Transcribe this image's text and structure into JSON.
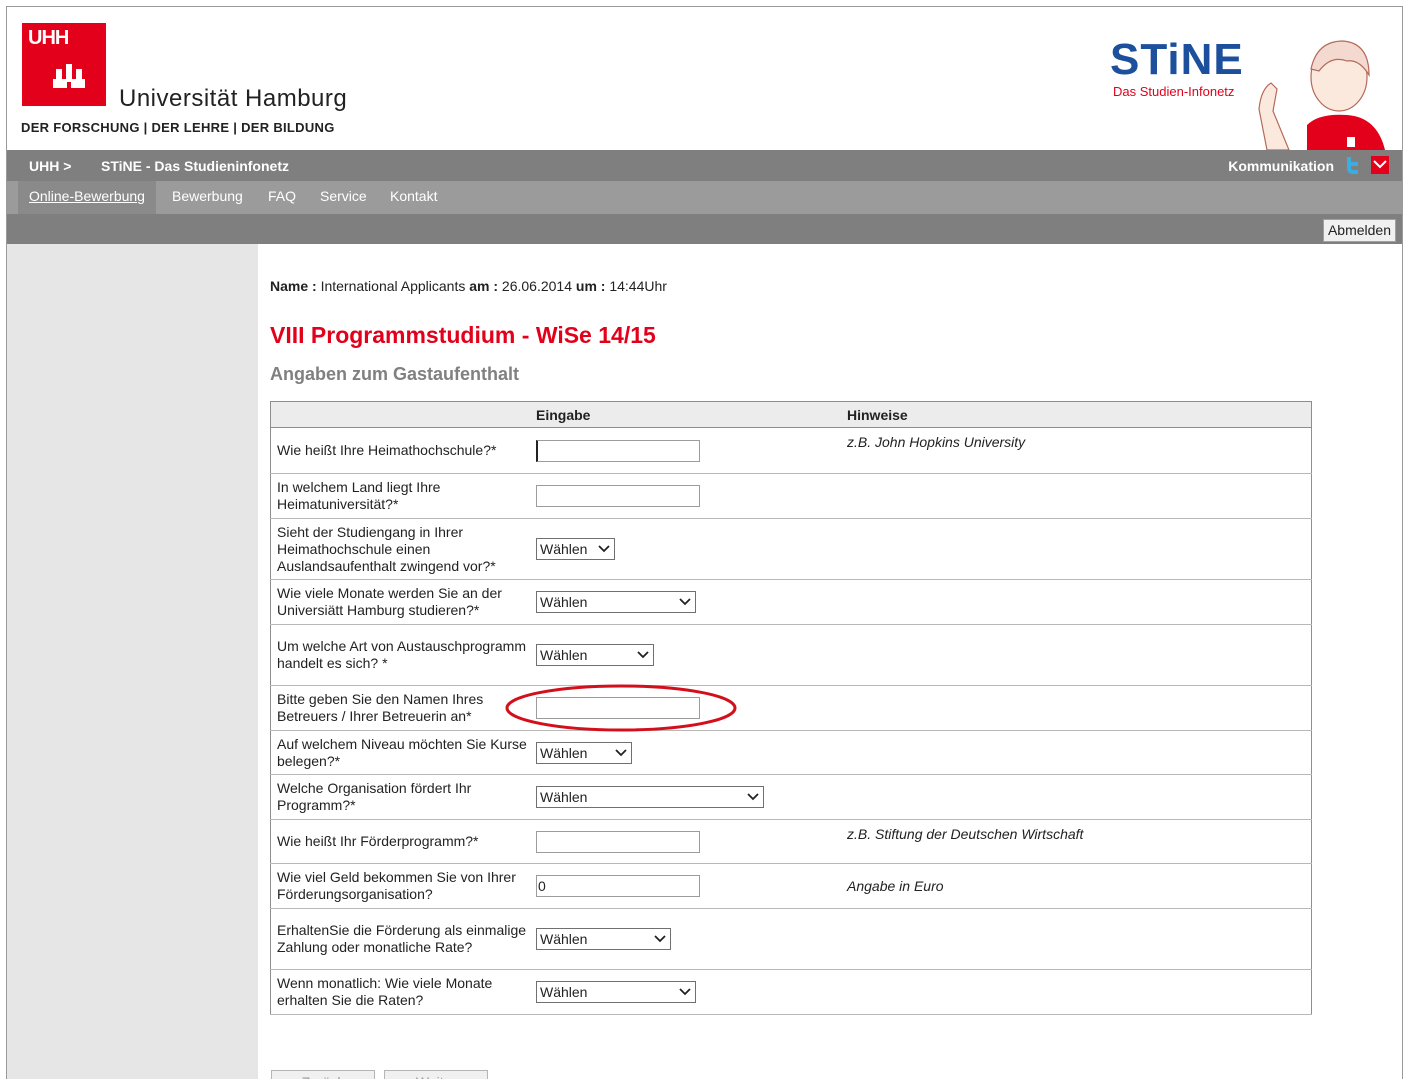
{
  "header": {
    "logo_abbr": "UHH",
    "university_name": "Universität Hamburg",
    "motto": "DER FORSCHUNG | DER LEHRE | DER BILDUNG",
    "stine_title": "STiNE",
    "stine_subtitle": "Das Studien-Infonetz"
  },
  "breadcrumb": {
    "home": "UHH >",
    "current": "STiNE - Das Studieninfonetz"
  },
  "topbar": {
    "communication": "Kommunikation",
    "twitter_icon": "twitter-icon",
    "mail_icon": "mail-icon"
  },
  "menu": {
    "items": [
      {
        "label": "Online-Bewerbung",
        "active": true
      },
      {
        "label": "Bewerbung"
      },
      {
        "label": "FAQ"
      },
      {
        "label": "Service"
      },
      {
        "label": "Kontakt"
      }
    ]
  },
  "logout_label": "Abmelden",
  "meta": {
    "name_label": "Name :",
    "name_value": "International Applicants",
    "date_label": "am :",
    "date_value": "26.06.2014",
    "time_label": "um :",
    "time_value": "14:44Uhr"
  },
  "page_title": "VIII Programmstudium - WiSe 14/15",
  "section_title": "Angaben zum Gastaufenthalt",
  "table": {
    "columns": [
      "",
      "Eingabe",
      "Hinweise"
    ],
    "rows": [
      {
        "question": "Wie heißt Ihre Heimathochschule?*",
        "input_type": "text",
        "value": "",
        "hint": "z.B. John Hopkins University"
      },
      {
        "question": "In welchem Land liegt Ihre Heimatuniversität?*",
        "input_type": "text",
        "value": "",
        "hint": ""
      },
      {
        "question": "Sieht der Studiengang in Ihrer Heimathochschule einen Auslandsaufenthalt zwingend vor?*",
        "input_type": "select",
        "value": "Wählen",
        "hint": ""
      },
      {
        "question": "Wie viele Monate werden Sie an der Universiätt Hamburg studieren?*",
        "input_type": "select",
        "value": "Wählen",
        "hint": ""
      },
      {
        "question": "Um welche Art von Austauschprogramm handelt es sich? *",
        "input_type": "select",
        "value": "Wählen",
        "hint": ""
      },
      {
        "question": "Bitte geben Sie den Namen Ihres Betreuers / Ihrer Betreuerin an*",
        "input_type": "text",
        "value": "",
        "hint": ""
      },
      {
        "question": "Auf welchem Niveau möchten Sie Kurse belegen?*",
        "input_type": "select",
        "value": "Wählen",
        "hint": ""
      },
      {
        "question": "Welche Organisation fördert Ihr Programm?*",
        "input_type": "select",
        "value": "Wählen",
        "hint": ""
      },
      {
        "question": "Wie heißt Ihr Förderprogramm?*",
        "input_type": "text",
        "value": "",
        "hint": "z.B. Stiftung der Deutschen Wirtschaft"
      },
      {
        "question": "Wie viel Geld bekommen Sie von Ihrer Förderungsorganisation?",
        "input_type": "text",
        "value": "0",
        "hint": "Angabe in Euro"
      },
      {
        "question": "ErhaltenSie die Förderung als einmalige Zahlung oder monatliche Rate?",
        "input_type": "select",
        "value": "Wählen",
        "hint": ""
      },
      {
        "question": "Wenn monatlich: Wie viele Monate erhalten Sie die Raten?",
        "input_type": "select",
        "value": "Wählen",
        "hint": ""
      }
    ]
  },
  "buttons": {
    "back": "Zurück",
    "next": "Weiter"
  },
  "colors": {
    "brand_red": "#e2001a",
    "stine_blue": "#1c4f9c",
    "nav_gray": "#7f7f7f"
  }
}
